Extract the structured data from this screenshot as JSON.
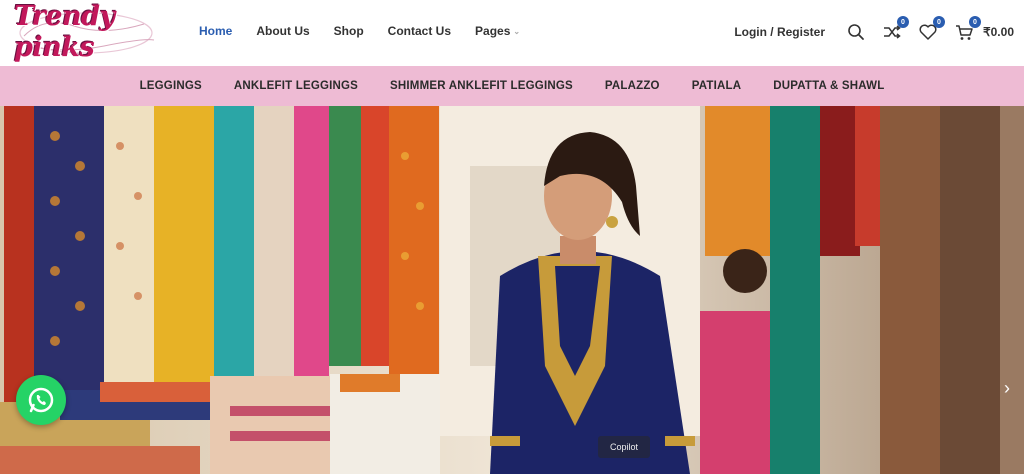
{
  "brand": {
    "logo_text": "Trendy pinks",
    "accent": "#2a5db0",
    "pink": "#eebbd4"
  },
  "main_nav": [
    {
      "label": "Home",
      "active": true
    },
    {
      "label": "About Us",
      "active": false
    },
    {
      "label": "Shop",
      "active": false
    },
    {
      "label": "Contact Us",
      "active": false
    },
    {
      "label": "Pages",
      "active": false
    }
  ],
  "header_right": {
    "login_label": "Login / Register",
    "compare_count": "0",
    "wishlist_count": "0",
    "cart_count": "0",
    "cart_total": "₹0.00",
    "icons": [
      "search-icon",
      "compare-icon",
      "heart-icon",
      "cart-icon"
    ]
  },
  "categories": [
    "LEGGINGS",
    "ANKLEFIT LEGGINGS",
    "SHIMMER ANKLEFIT LEGGINGS",
    "PALAZZO",
    "PATIALA",
    "DUPATTA & SHAWL"
  ],
  "hero": {
    "watermark": "Copilot"
  }
}
